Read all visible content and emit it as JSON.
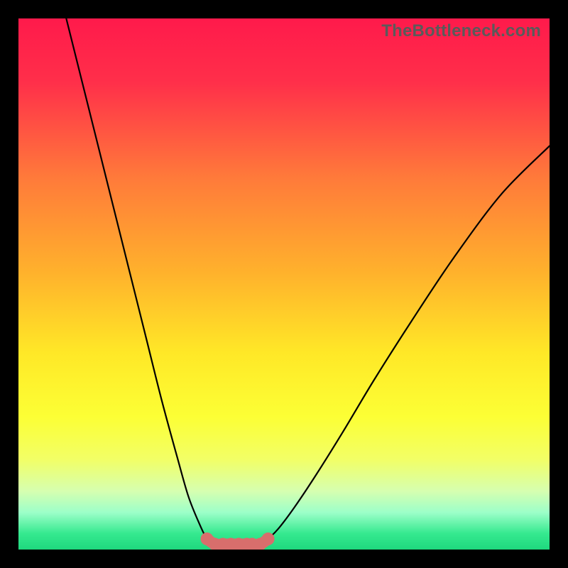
{
  "watermark": {
    "text": "TheBottleneck.com"
  },
  "chart_data": {
    "type": "line",
    "title": "",
    "xlabel": "",
    "ylabel": "",
    "xlim": [
      0,
      100
    ],
    "ylim": [
      0,
      100
    ],
    "grid": false,
    "series": [
      {
        "name": "bottleneck-curve-left",
        "x": [
          9,
          12,
          15,
          18,
          21,
          24,
          27,
          30,
          32,
          34,
          35.5,
          37,
          38.5
        ],
        "values": [
          100,
          88,
          76,
          64,
          52,
          40,
          28,
          17,
          10,
          5,
          2,
          1,
          1
        ]
      },
      {
        "name": "bottleneck-curve-right",
        "x": [
          44,
          45.5,
          47,
          49,
          52,
          56,
          61,
          67,
          74,
          82,
          91,
          100
        ],
        "values": [
          1,
          1,
          2,
          4,
          8,
          14,
          22,
          32,
          43,
          55,
          67,
          76
        ]
      },
      {
        "name": "marker-band",
        "x": [
          35.5,
          37,
          38.5,
          40,
          41.5,
          43,
          44,
          45.5,
          47
        ],
        "values": [
          2,
          1,
          1,
          1,
          1,
          1,
          1,
          1,
          2
        ]
      }
    ],
    "gradient_stops": [
      {
        "pct": 0,
        "color": "#ff1a4b"
      },
      {
        "pct": 12,
        "color": "#ff2f4a"
      },
      {
        "pct": 30,
        "color": "#ff7a3a"
      },
      {
        "pct": 48,
        "color": "#ffb22c"
      },
      {
        "pct": 63,
        "color": "#ffe827"
      },
      {
        "pct": 75,
        "color": "#fcff35"
      },
      {
        "pct": 83,
        "color": "#f2ff66"
      },
      {
        "pct": 89,
        "color": "#d6ffb0"
      },
      {
        "pct": 93,
        "color": "#9dffc9"
      },
      {
        "pct": 97,
        "color": "#35e98f"
      },
      {
        "pct": 100,
        "color": "#1fd87e"
      }
    ],
    "marker_color": "#d86e6c",
    "curve_color": "#000000"
  }
}
